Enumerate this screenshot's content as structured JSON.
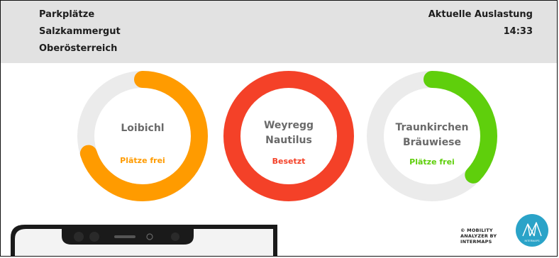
{
  "header": {
    "left_lines": [
      "Parkplätze",
      "Salzkammergut",
      "Oberösterreich"
    ],
    "title": "Aktuelle Auslastung",
    "time": "14:33"
  },
  "gauges": [
    {
      "name_lines": [
        "Loibichl"
      ],
      "status": "Plätze frei",
      "color": "#ff9b00",
      "status_color": "#ff9b00",
      "occupancy_fraction": 0.7
    },
    {
      "name_lines": [
        "Weyregg",
        "Nautilus"
      ],
      "status": "Besetzt",
      "color": "#f44128",
      "status_color": "#f44128",
      "occupancy_fraction": 1.0
    },
    {
      "name_lines": [
        "Traunkirchen",
        "Bräuwiese"
      ],
      "status": "Plätze frei",
      "color": "#5fcf0c",
      "status_color": "#5fcf0c",
      "occupancy_fraction": 0.37
    }
  ],
  "footer": {
    "credit_lines": [
      "© MOBILITY",
      "ANALYZER BY",
      "INTERMAPS"
    ],
    "logo_text": "INTERMAPS",
    "logo_color": "#2aa3c8"
  }
}
